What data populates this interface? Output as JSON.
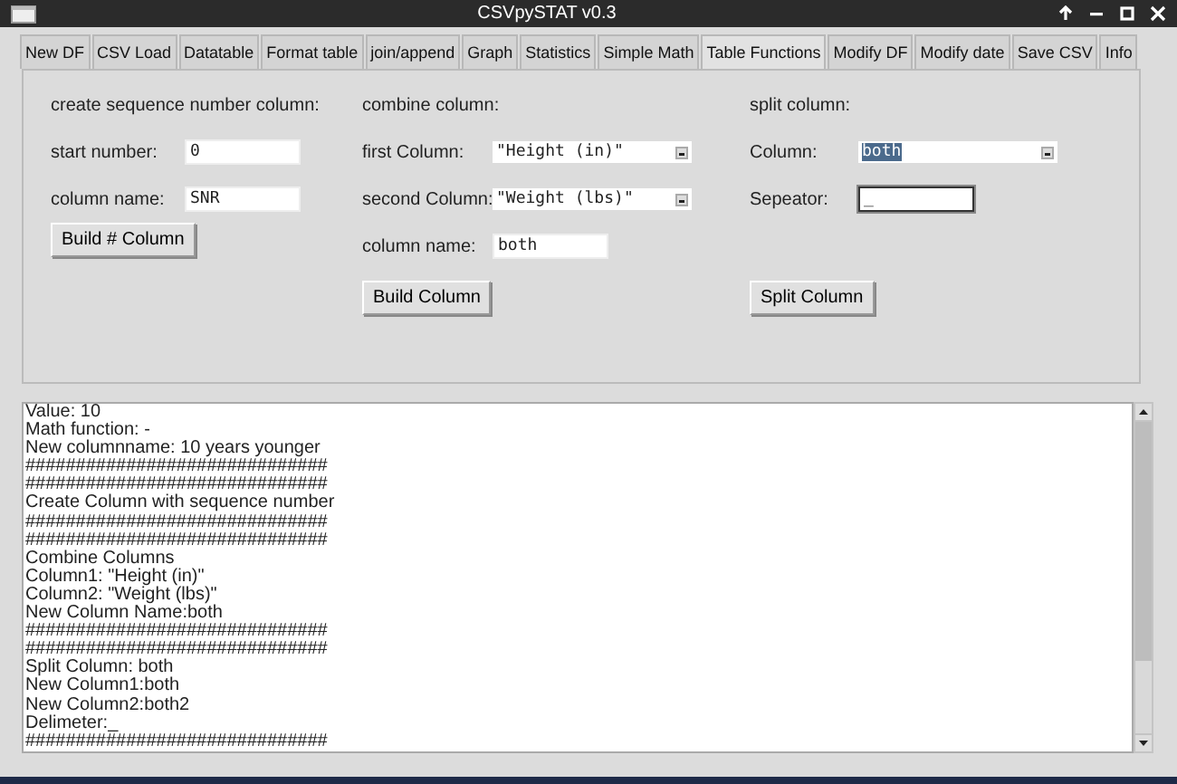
{
  "window": {
    "title": "CSVpySTAT v0.3"
  },
  "tabs": [
    {
      "label": "New DF",
      "selected": false
    },
    {
      "label": "CSV Load",
      "selected": false
    },
    {
      "label": "Datatable",
      "selected": false
    },
    {
      "label": "Format table",
      "selected": false
    },
    {
      "label": "join/append",
      "selected": false
    },
    {
      "label": "Graph",
      "selected": false
    },
    {
      "label": "Statistics",
      "selected": false
    },
    {
      "label": "Simple Math",
      "selected": false
    },
    {
      "label": "Table Functions",
      "selected": true
    },
    {
      "label": "Modify DF",
      "selected": false
    },
    {
      "label": "Modify date",
      "selected": false
    },
    {
      "label": "Save CSV",
      "selected": false
    },
    {
      "label": "Info",
      "selected": false
    }
  ],
  "sections": [
    {
      "heading": "create sequence number column:",
      "rows": [
        {
          "kind": "entry",
          "label": "start number:",
          "value": "0",
          "focused": false
        },
        {
          "kind": "entry",
          "label": "column name:",
          "value": "SNR",
          "focused": false
        }
      ],
      "button": "Build # Column"
    },
    {
      "heading": "combine column:",
      "rows": [
        {
          "kind": "combo",
          "label": "first Column:",
          "value": "\"Height (in)\"",
          "highlighted": false
        },
        {
          "kind": "combo",
          "label": "second Column:",
          "value": "\"Weight (lbs)\"",
          "highlighted": false
        },
        {
          "kind": "entry",
          "label": "column name:",
          "value": "both",
          "focused": false
        }
      ],
      "button": "Build Column"
    },
    {
      "heading": "split column:",
      "rows": [
        {
          "kind": "combo",
          "label": "Column:",
          "value": "both",
          "highlighted": true
        },
        {
          "kind": "entry",
          "label": "Sepeator:",
          "value": "_",
          "focused": true
        }
      ],
      "button": "Split Column"
    }
  ],
  "log": [
    "Value: 10",
    "Math function: -",
    "New columnname: 10 years younger",
    "##############################",
    "##############################",
    "Create Column with sequence number",
    "##############################",
    "##############################",
    "Combine Columns",
    "Column1: \"Height (in)\"",
    "Column2: \"Weight (lbs)\"",
    "New Column Name:both",
    "##############################",
    "##############################",
    "Split Column: both",
    "New Column1:both",
    "New Column2:both2",
    "Delimeter:_",
    "##############################"
  ]
}
